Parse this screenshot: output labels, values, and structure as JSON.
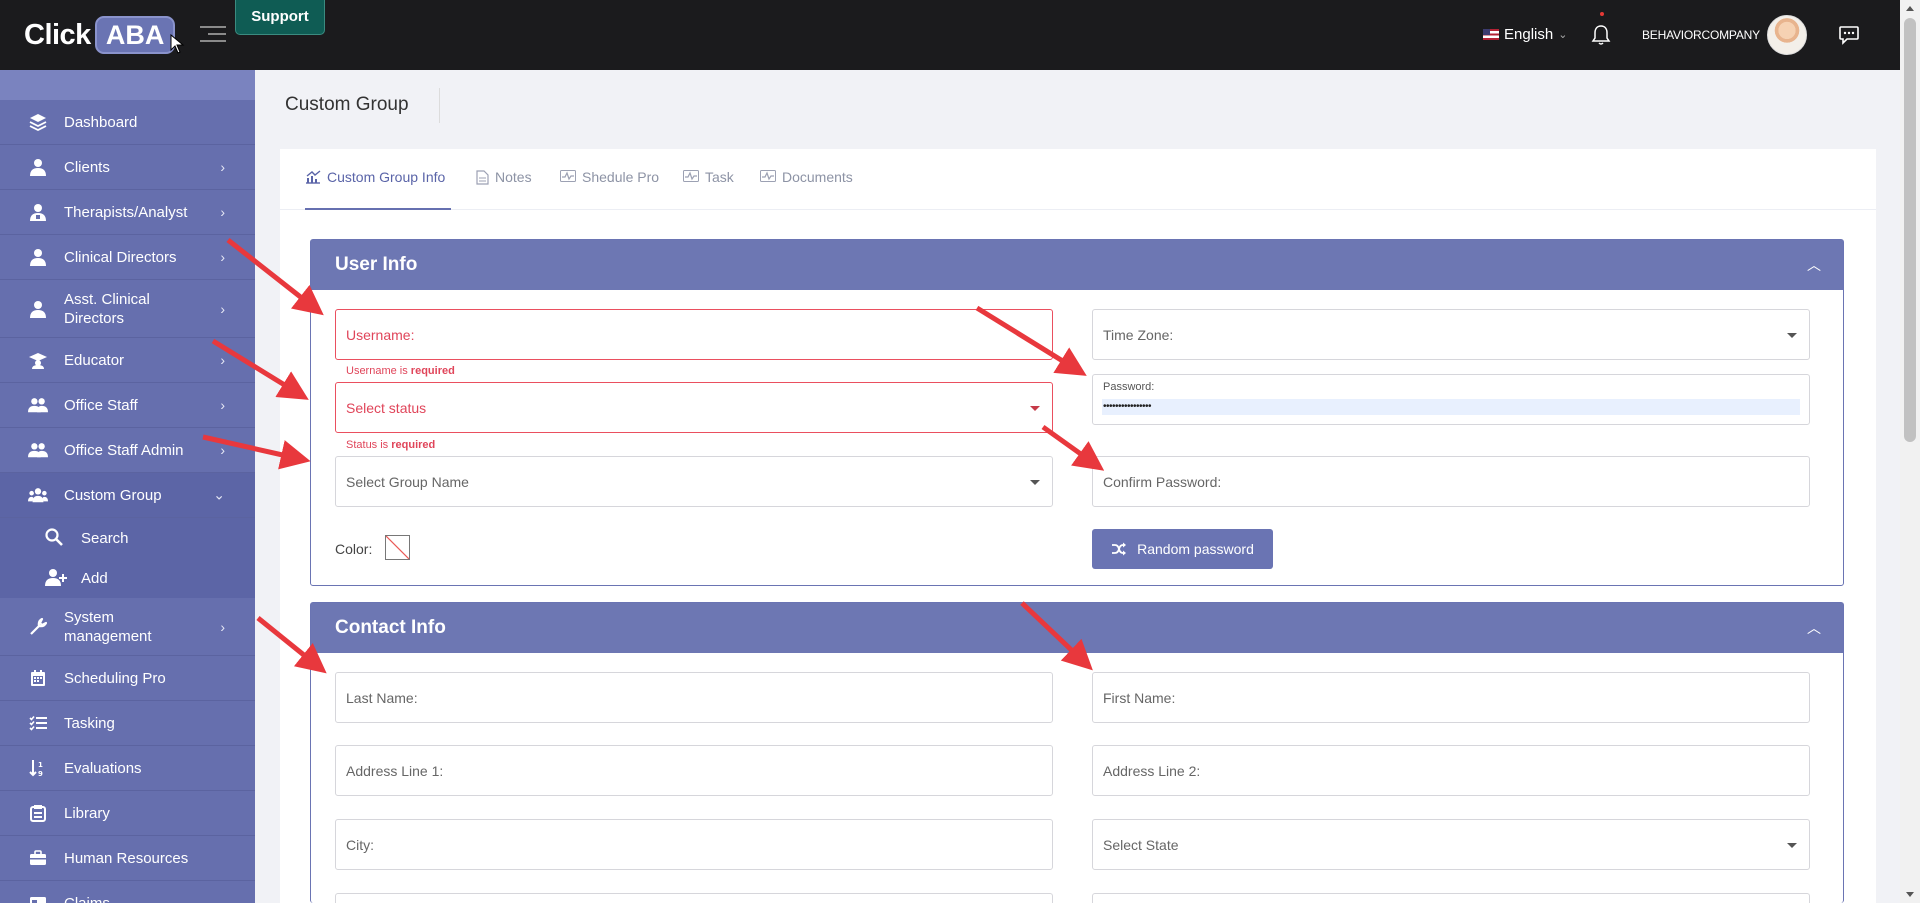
{
  "app": {
    "logo_click": "Click",
    "logo_aba": "ABA",
    "support_label": "Support"
  },
  "header": {
    "language": "English",
    "company": "BEHAVIORCOMPANY"
  },
  "sidebar": {
    "items": [
      {
        "label": "Dashboard",
        "icon": "layers-icon",
        "chevron": ""
      },
      {
        "label": "Clients",
        "icon": "person-icon",
        "chevron": "›"
      },
      {
        "label": "Therapists/Analyst",
        "icon": "therapist-icon",
        "chevron": "›"
      },
      {
        "label": "Clinical Directors",
        "icon": "person-icon",
        "chevron": "›"
      },
      {
        "label": "Asst. Clinical Directors",
        "icon": "person-icon",
        "chevron": "›"
      },
      {
        "label": "Educator",
        "icon": "graduation-cap-icon",
        "chevron": "›"
      },
      {
        "label": "Office Staff",
        "icon": "users-icon",
        "chevron": "›"
      },
      {
        "label": "Office Staff Admin",
        "icon": "users-icon",
        "chevron": "›"
      },
      {
        "label": "Custom Group",
        "icon": "group-icon",
        "chevron": "⌄"
      },
      {
        "label": "Search",
        "icon": "search-icon"
      },
      {
        "label": "Add",
        "icon": "add-user-icon"
      },
      {
        "label": "System management",
        "icon": "wrench-icon",
        "chevron": "›"
      },
      {
        "label": "Scheduling Pro",
        "icon": "calendar-icon",
        "chevron": ""
      },
      {
        "label": "Tasking",
        "icon": "checklist-icon",
        "chevron": ""
      },
      {
        "label": "Evaluations",
        "icon": "sort-icon",
        "chevron": ""
      },
      {
        "label": "Library",
        "icon": "library-icon",
        "chevron": ""
      },
      {
        "label": "Human Resources",
        "icon": "briefcase-icon",
        "chevron": ""
      },
      {
        "label": "Claims",
        "icon": "claims-icon",
        "chevron": ""
      }
    ]
  },
  "page": {
    "title": "Custom Group"
  },
  "tabs": [
    {
      "label": "Custom Group Info",
      "icon": "chart-icon",
      "active": true
    },
    {
      "label": "Notes",
      "icon": "document-icon",
      "active": false
    },
    {
      "label": "Shedule Pro",
      "icon": "pulse-icon",
      "active": false
    },
    {
      "label": "Task",
      "icon": "pulse-icon",
      "active": false
    },
    {
      "label": "Documents",
      "icon": "pulse-icon",
      "active": false
    }
  ],
  "user_info": {
    "title": "User Info",
    "username_placeholder": "Username:",
    "username_error_prefix": "Username is ",
    "username_error_strong": "required",
    "status_placeholder": "Select status",
    "status_error_prefix": "Status is ",
    "status_error_strong": "required",
    "group_placeholder": "Select Group Name",
    "color_label": "Color:",
    "timezone_placeholder": "Time Zone:",
    "password_label": "Password:",
    "password_value": "••••••••••••••••",
    "confirm_placeholder": "Confirm Password:",
    "random_password_label": "Random password"
  },
  "contact_info": {
    "title": "Contact Info",
    "last_name_placeholder": "Last Name:",
    "first_name_placeholder": "First Name:",
    "address1_placeholder": "Address Line 1:",
    "address2_placeholder": "Address Line 2:",
    "city_placeholder": "City:",
    "state_placeholder": "Select State"
  },
  "colors": {
    "sidebar": "#666fae",
    "accent": "#6d77b3",
    "error": "#e0455a",
    "annotation_arrow": "#e8383d"
  }
}
